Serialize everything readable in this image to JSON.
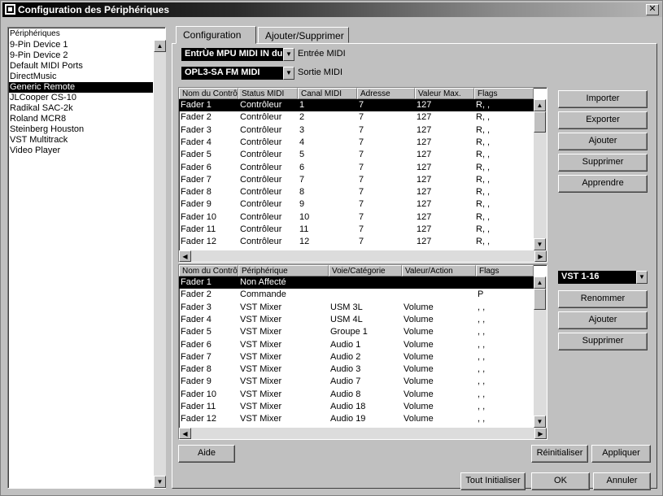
{
  "window": {
    "title": "Configuration des Périphériques",
    "close_glyph": "✕"
  },
  "devices": {
    "header": "Périphériques",
    "items": [
      "9-Pin Device 1",
      "9-Pin Device 2",
      "Default MIDI Ports",
      "DirectMusic",
      "Generic Remote",
      "JLCooper CS-10",
      "Radikal SAC-2k",
      "Roland MCR8",
      "Steinberg Houston",
      "VST Multitrack",
      "Video Player"
    ],
    "selected_index": 4
  },
  "tabs": [
    "Configuration",
    "Ajouter/Supprimer"
  ],
  "midi_in": {
    "value": "EntrÙe MPU MIDI IN du C",
    "label": "Entrée MIDI"
  },
  "midi_out": {
    "value": "OPL3-SA FM MIDI",
    "label": "Sortie MIDI"
  },
  "table1": {
    "headers": [
      "Nom du Contrô",
      "Status MIDI",
      "Canal MIDI",
      "Adresse",
      "Valeur Max.",
      "Flags"
    ],
    "rows": [
      [
        "Fader 1",
        "Contrôleur",
        "1",
        "7",
        "127",
        "R, ,"
      ],
      [
        "Fader 2",
        "Contrôleur",
        "2",
        "7",
        "127",
        "R, ,"
      ],
      [
        "Fader 3",
        "Contrôleur",
        "3",
        "7",
        "127",
        "R, ,"
      ],
      [
        "Fader 4",
        "Contrôleur",
        "4",
        "7",
        "127",
        "R, ,"
      ],
      [
        "Fader 5",
        "Contrôleur",
        "5",
        "7",
        "127",
        "R, ,"
      ],
      [
        "Fader 6",
        "Contrôleur",
        "6",
        "7",
        "127",
        "R, ,"
      ],
      [
        "Fader 7",
        "Contrôleur",
        "7",
        "7",
        "127",
        "R, ,"
      ],
      [
        "Fader 8",
        "Contrôleur",
        "8",
        "7",
        "127",
        "R, ,"
      ],
      [
        "Fader 9",
        "Contrôleur",
        "9",
        "7",
        "127",
        "R, ,"
      ],
      [
        "Fader 10",
        "Contrôleur",
        "10",
        "7",
        "127",
        "R, ,"
      ],
      [
        "Fader 11",
        "Contrôleur",
        "11",
        "7",
        "127",
        "R, ,"
      ],
      [
        "Fader 12",
        "Contrôleur",
        "12",
        "7",
        "127",
        "R, ,"
      ]
    ],
    "selected_index": 0
  },
  "buttons_top": [
    "Importer",
    "Exporter",
    "Ajouter",
    "Supprimer",
    "Apprendre"
  ],
  "table2": {
    "headers": [
      "Nom du Contrô",
      "Périphérique",
      "Voie/Catégorie",
      "Valeur/Action",
      "Flags"
    ],
    "rows": [
      [
        "Fader 1",
        "Non Affecté",
        "",
        "",
        ""
      ],
      [
        "Fader 2",
        "Commande",
        "",
        "",
        "P"
      ],
      [
        "Fader 3",
        "VST Mixer",
        "USM 3L",
        "Volume",
        ", ,"
      ],
      [
        "Fader 4",
        "VST Mixer",
        "USM 4L",
        "Volume",
        ", ,"
      ],
      [
        "Fader 5",
        "VST Mixer",
        "Groupe 1",
        "Volume",
        ", ,"
      ],
      [
        "Fader 6",
        "VST Mixer",
        "Audio 1",
        "Volume",
        ", ,"
      ],
      [
        "Fader 7",
        "VST Mixer",
        "Audio 2",
        "Volume",
        ", ,"
      ],
      [
        "Fader 8",
        "VST Mixer",
        "Audio 3",
        "Volume",
        ", ,"
      ],
      [
        "Fader 9",
        "VST Mixer",
        "Audio 7",
        "Volume",
        ", ,"
      ],
      [
        "Fader 10",
        "VST Mixer",
        "Audio 8",
        "Volume",
        ", ,"
      ],
      [
        "Fader 11",
        "VST Mixer",
        "Audio 18",
        "Volume",
        ", ,"
      ],
      [
        "Fader 12",
        "VST Mixer",
        "Audio 19",
        "Volume",
        ", ,"
      ]
    ],
    "selected_index": 0
  },
  "bank_select": {
    "value": "VST 1-16"
  },
  "buttons_bottom": [
    "Renommer",
    "Ajouter",
    "Supprimer"
  ],
  "footer": {
    "aide": "Aide",
    "reinitialiser": "Réinitialiser",
    "appliquer": "Appliquer",
    "tout_initialiser": "Tout Initialiser",
    "ok": "OK",
    "annuler": "Annuler"
  }
}
